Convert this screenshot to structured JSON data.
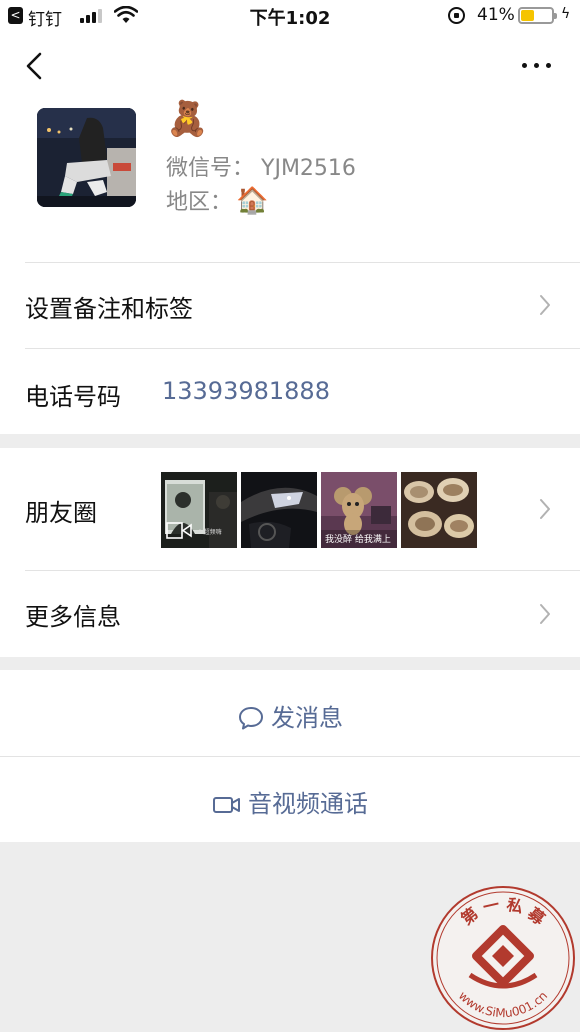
{
  "status_bar": {
    "back_glyph": "<",
    "back_app": "钉钉",
    "time": "下午1:02",
    "battery_percent": "41%",
    "battery_level": 0.41,
    "bolt_glyph": "ϟ",
    "signal_bars": 3,
    "icons": [
      "signal-bars-icon",
      "wifi-icon",
      "orientation-lock-icon",
      "battery-icon",
      "charging-bolt-icon"
    ]
  },
  "nav": {
    "back_icon": "chevron-left-icon",
    "more_icon": "more-dots-icon"
  },
  "profile": {
    "nickname": "🧸",
    "wechat_id_label": "微信号：",
    "wechat_id": "YJM2516",
    "region_label": "地区：",
    "region_value": "🏠"
  },
  "rows": {
    "remark_tags": "设置备注和标签",
    "phone_label": "电话号码",
    "phone_value": "13393981888",
    "moments_label": "朋友圈",
    "more_info": "更多信息"
  },
  "moments_thumbs": {
    "thumb_3_caption": "我没醉 给我满上",
    "thumb_1_caption": "ᐅ超频嗨"
  },
  "actions": {
    "message": "发消息",
    "video_call": "音视频通话"
  },
  "watermark": {
    "top_text": "第 一 私 募",
    "bottom_text": "www.SiMu001.cn"
  },
  "colors": {
    "link_blue": "#576b95",
    "background": "#ededed",
    "battery_yellow": "#f5c400",
    "watermark_red": "#b23a2e"
  }
}
